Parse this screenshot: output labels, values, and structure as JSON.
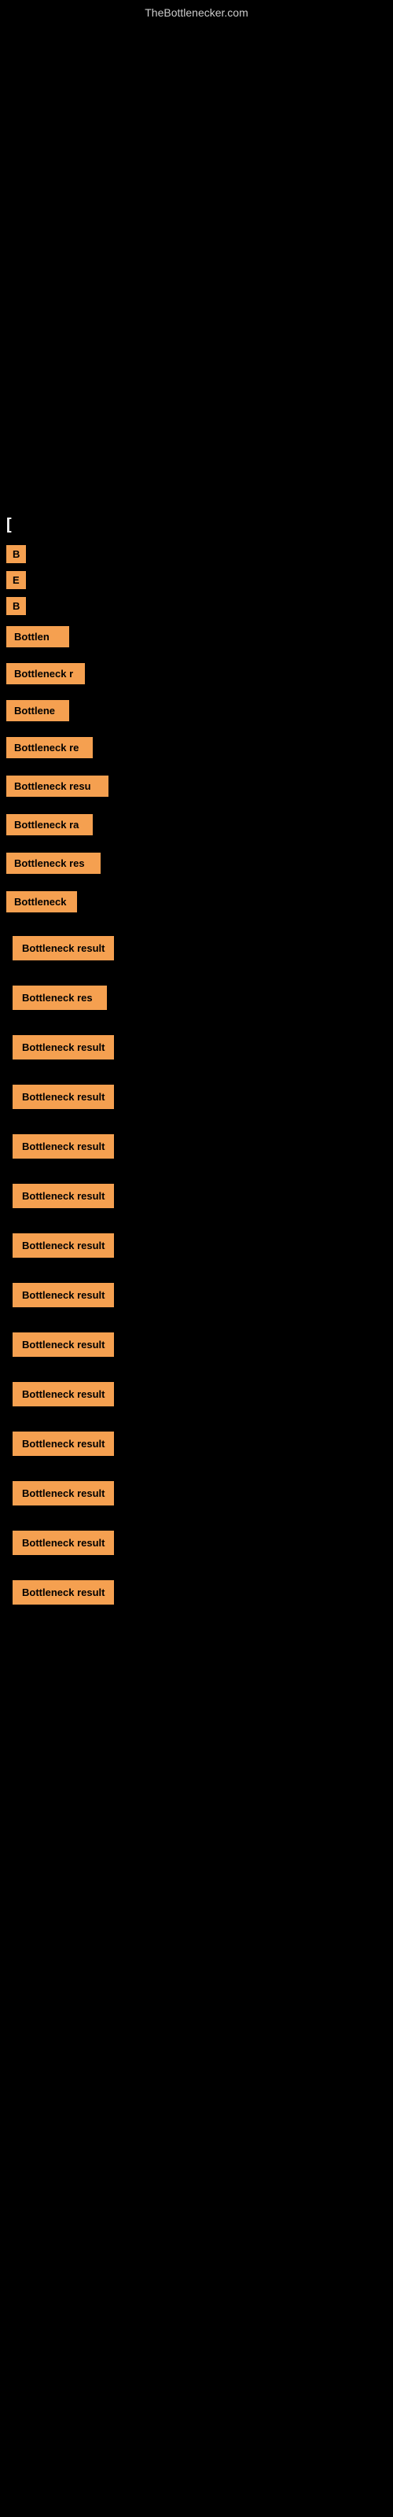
{
  "site": {
    "title": "TheBottlenecker.com"
  },
  "header": {
    "section_label": "["
  },
  "labels": {
    "b": "B",
    "e": "E",
    "b2": "B",
    "bottlen": "Bottlen",
    "bottleneck_r": "Bottleneck r",
    "bottlene": "Bottlene",
    "bottleneck_re": "Bottleneck re",
    "bottleneck_resu": "Bottleneck resu",
    "bottleneck_ra": "Bottleneck ra",
    "bottleneck_res": "Bottleneck res",
    "bottleneck2": "Bottleneck"
  },
  "results": [
    {
      "label": "Bottleneck result",
      "width": 140
    },
    {
      "label": "Bottleneck res",
      "width": 120
    },
    {
      "label": "Bottleneck result",
      "width": 145
    },
    {
      "label": "Bottleneck result",
      "width": 145
    },
    {
      "label": "Bottleneck result",
      "width": 145
    },
    {
      "label": "Bottleneck result",
      "width": 145
    },
    {
      "label": "Bottleneck result",
      "width": 145
    },
    {
      "label": "Bottleneck result",
      "width": 145
    },
    {
      "label": "Bottleneck result",
      "width": 145
    },
    {
      "label": "Bottleneck result",
      "width": 145
    },
    {
      "label": "Bottleneck result",
      "width": 145
    },
    {
      "label": "Bottleneck result",
      "width": 145
    },
    {
      "label": "Bottleneck result",
      "width": 145
    },
    {
      "label": "Bottleneck result",
      "width": 145
    }
  ]
}
